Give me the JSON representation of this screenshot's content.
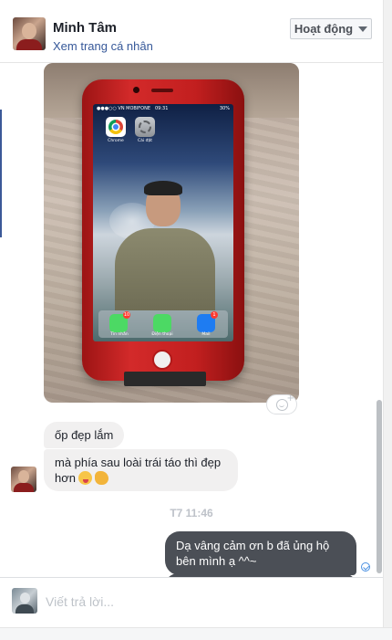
{
  "header": {
    "contact_name": "Minh Tâm",
    "profile_link": "Xem trang cá nhân",
    "status_button": "Hoạt động"
  },
  "photo": {
    "statusbar": {
      "carrier": "●●●○○ VN MOBIFONE",
      "time": "09:31",
      "battery": "30%"
    },
    "apps": [
      {
        "label": "Chrome",
        "icon": "chrome-icon"
      },
      {
        "label": "Cài đặt",
        "icon": "settings-icon"
      }
    ],
    "dock": [
      {
        "label": "Tin nhắn",
        "icon": "messages-icon",
        "badge": "10"
      },
      {
        "label": "Điện thoại",
        "icon": "phone-icon"
      },
      {
        "label": "Mail",
        "icon": "mail-icon",
        "badge": "1"
      }
    ]
  },
  "messages": [
    {
      "direction": "incoming",
      "text": "ốp đẹp lắm"
    },
    {
      "direction": "incoming",
      "text": "mà phía sau loài trái táo thì đẹp hơn",
      "emojis": [
        "wink-tongue-emoji",
        "clap-emoji"
      ]
    }
  ],
  "timestamp": "T7 11:46",
  "outgoing": [
    {
      "direction": "outgoing",
      "text": "Dạ vâng cảm ơn b đã ủng hộ bên mình ạ ^^~"
    }
  ],
  "composer": {
    "placeholder": "Viết trả lời..."
  },
  "colors": {
    "link": "#365899",
    "incoming_bubble": "#f1f0f0",
    "outgoing_bubble": "#4b4f56",
    "timestamp": "#bec2c9"
  }
}
